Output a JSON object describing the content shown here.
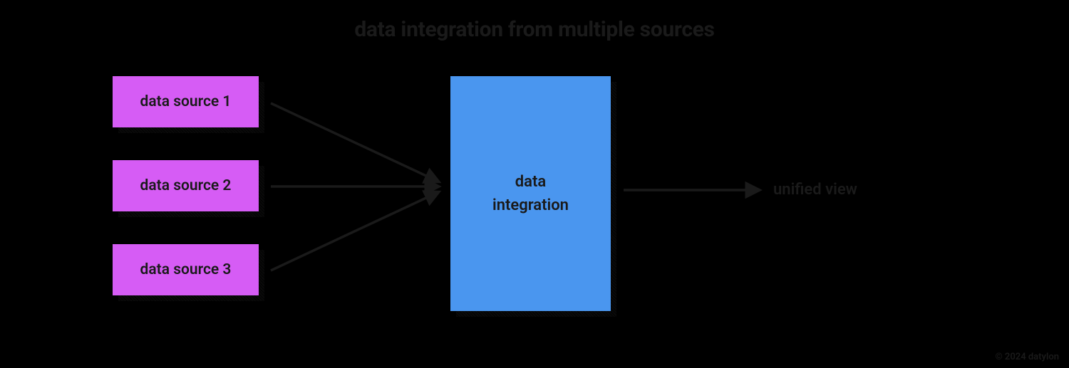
{
  "title": "data integration from multiple sources",
  "sources": [
    {
      "label": "data source 1"
    },
    {
      "label": "data source 2"
    },
    {
      "label": "data source 3"
    }
  ],
  "integration": {
    "label": "data\nintegration"
  },
  "output": {
    "label": "unified view"
  },
  "watermark": "© 2024 datylon"
}
